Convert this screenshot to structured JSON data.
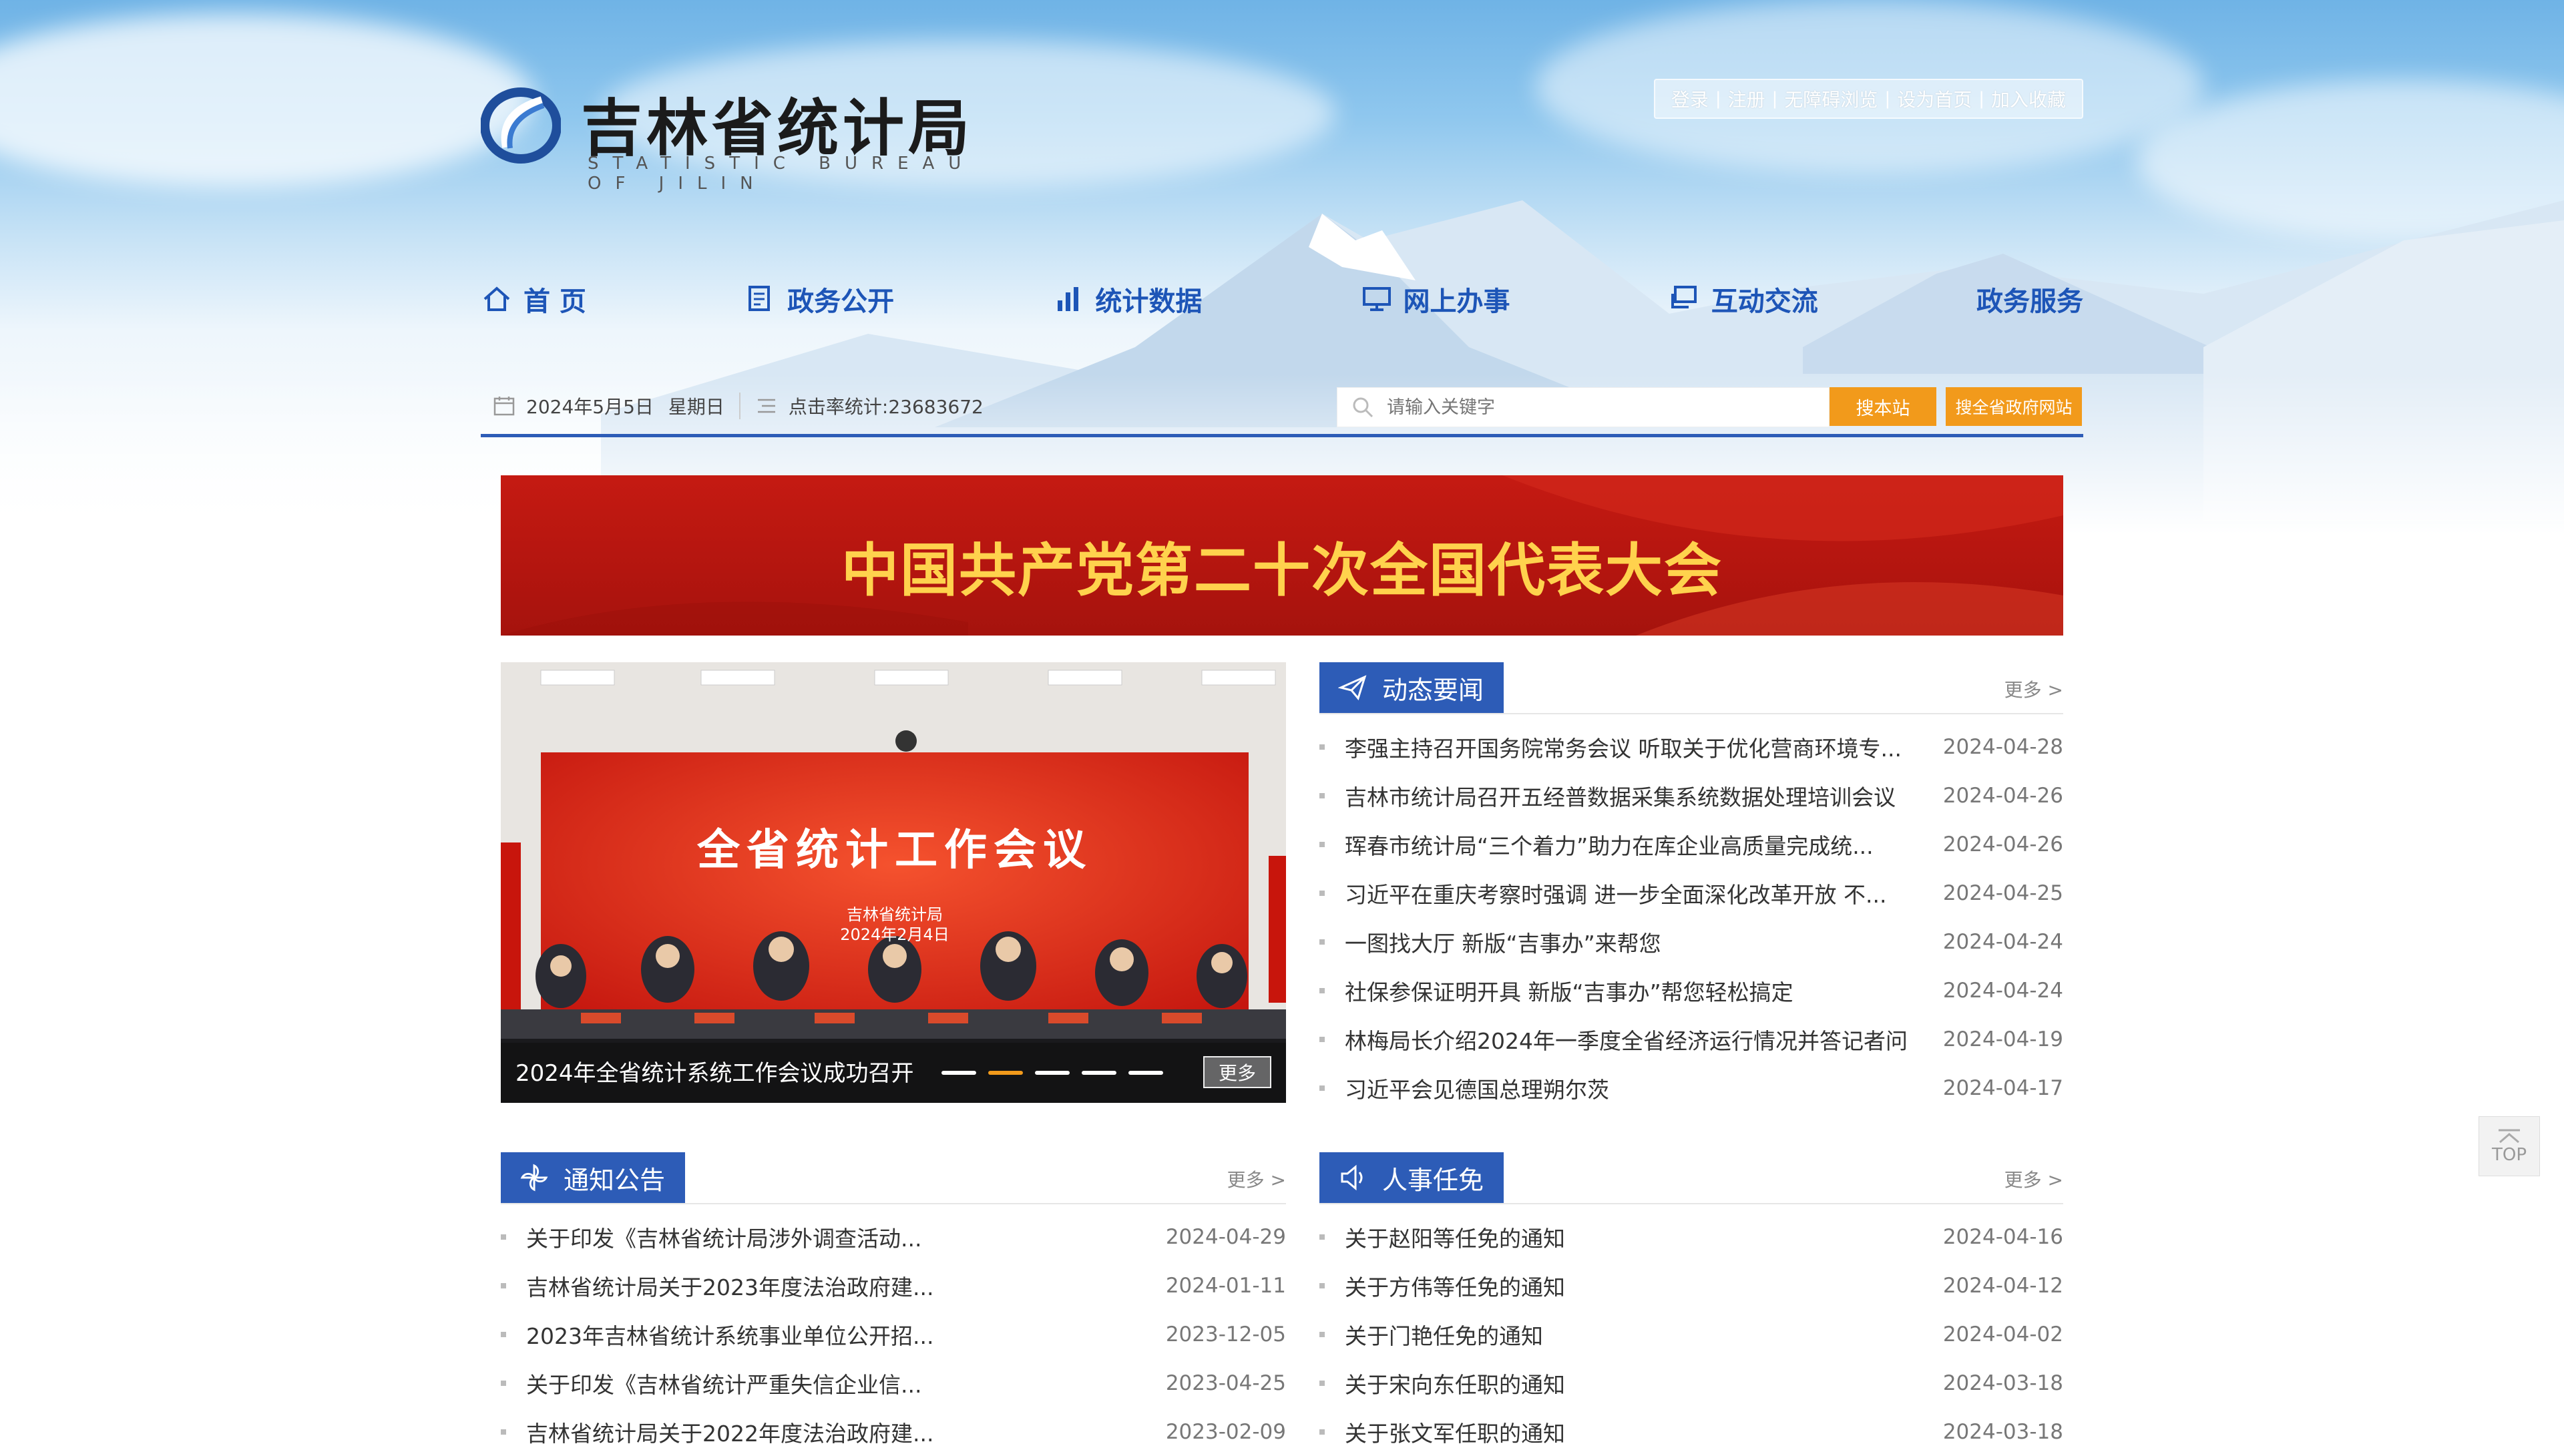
{
  "header": {
    "logo_cn": "吉林省统计局",
    "logo_en": "STATISTIC BUREAU OF JILIN",
    "top_links": [
      "登录",
      "注册",
      "无障碍浏览",
      "设为首页",
      "加入收藏"
    ]
  },
  "nav": {
    "items": [
      {
        "label": "首 页",
        "icon": "home-icon"
      },
      {
        "label": "政务公开",
        "icon": "document-icon"
      },
      {
        "label": "统计数据",
        "icon": "bar-chart-icon"
      },
      {
        "label": "网上办事",
        "icon": "monitor-icon"
      },
      {
        "label": "互动交流",
        "icon": "chat-icon"
      },
      {
        "label": "政务服务",
        "icon": ""
      }
    ]
  },
  "infobar": {
    "date": "2024年5月5日",
    "weekday": "星期日",
    "hits": "点击率统计:23683672",
    "search_placeholder": "请输入关键字",
    "search_site": "搜本站",
    "search_gov": "搜全省政府网站"
  },
  "banner": {
    "title": "中国共产党第二十次全国代表大会"
  },
  "slider": {
    "screen_title": "全省统计工作会议",
    "screen_org": "吉林省统计局",
    "screen_date": "2024年2月4日",
    "caption": "2024年全省统计系统工作会议成功召开",
    "more": "更多",
    "active_dot": 1,
    "dot_count": 5
  },
  "news": {
    "title": "动态要闻",
    "more": "更多 >",
    "items": [
      {
        "title": "李强主持召开国务院常务会议 听取关于优化营商环境专...",
        "date": "2024-04-28"
      },
      {
        "title": "吉林市统计局召开五经普数据采集系统数据处理培训会议",
        "date": "2024-04-26"
      },
      {
        "title": "珲春市统计局“三个着力”助力在库企业高质量完成统...",
        "date": "2024-04-26"
      },
      {
        "title": "习近平在重庆考察时强调 进一步全面深化改革开放 不...",
        "date": "2024-04-25"
      },
      {
        "title": "一图找大厅 新版“吉事办”来帮您",
        "date": "2024-04-24"
      },
      {
        "title": "社保参保证明开具 新版“吉事办”帮您轻松搞定",
        "date": "2024-04-24"
      },
      {
        "title": "林梅局长介绍2024年一季度全省经济运行情况并答记者问",
        "date": "2024-04-19"
      },
      {
        "title": "习近平会见德国总理朔尔茨",
        "date": "2024-04-17"
      }
    ]
  },
  "notice": {
    "title": "通知公告",
    "more": "更多 >",
    "items": [
      {
        "title": "关于印发《吉林省统计局涉外调查活动...",
        "date": "2024-04-29"
      },
      {
        "title": "吉林省统计局关于2023年度法治政府建...",
        "date": "2024-01-11"
      },
      {
        "title": "2023年吉林省统计系统事业单位公开招...",
        "date": "2023-12-05"
      },
      {
        "title": "关于印发《吉林省统计严重失信企业信...",
        "date": "2023-04-25"
      },
      {
        "title": "吉林省统计局关于2022年度法治政府建...",
        "date": "2023-02-09"
      }
    ]
  },
  "personnel": {
    "title": "人事任免",
    "more": "更多 >",
    "items": [
      {
        "title": "关于赵阳等任免的通知",
        "date": "2024-04-16"
      },
      {
        "title": "关于方伟等任免的通知",
        "date": "2024-04-12"
      },
      {
        "title": "关于门艳任免的通知",
        "date": "2024-04-02"
      },
      {
        "title": "关于宋向东任职的通知",
        "date": "2024-03-18"
      },
      {
        "title": "关于张文军任职的通知",
        "date": "2024-03-18"
      }
    ]
  },
  "totop": {
    "label": "TOP"
  },
  "colors": {
    "nav_blue": "#1d55b7",
    "panel_blue": "#2d5cb7",
    "orange": "#f29a1b",
    "banner_red": "#c51a12",
    "banner_gold": "#ffd24d"
  }
}
